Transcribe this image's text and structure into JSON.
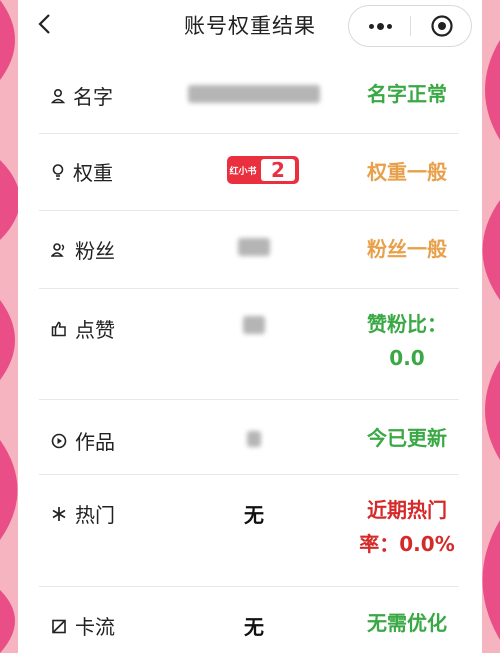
{
  "header": {
    "title": "账号权重结果"
  },
  "rows": [
    {
      "label": "名字",
      "icon": "person-icon",
      "status": "名字正常",
      "status_color": "#3aa845"
    },
    {
      "label": "权重",
      "icon": "lightbulb-icon",
      "badge_brand": "红小书",
      "badge_value": "2",
      "status": "权重一般",
      "status_color": "#e8a04a"
    },
    {
      "label": "粉丝",
      "icon": "fans-icon",
      "status": "粉丝一般",
      "status_color": "#e8a04a"
    },
    {
      "label": "点赞",
      "icon": "like-icon",
      "status_line1": "赞粉比：",
      "status_line2": "0.0",
      "status_color": "#3aa845"
    },
    {
      "label": "作品",
      "icon": "play-icon",
      "status": "今已更新",
      "status_color": "#3aa845"
    },
    {
      "label": "热门",
      "icon": "star-icon",
      "value": "无",
      "status_line1": "近期热门",
      "status_line2": "率：0.0%",
      "status_color": "#d52a2a"
    },
    {
      "label": "卡流",
      "icon": "limit-icon",
      "value": "无",
      "status": "无需优化",
      "status_color": "#3aa845"
    }
  ],
  "colors": {
    "accent_green": "#3aa845",
    "accent_orange": "#e8a04a",
    "accent_red": "#d52a2a",
    "brand_red": "#ea2f3f"
  }
}
